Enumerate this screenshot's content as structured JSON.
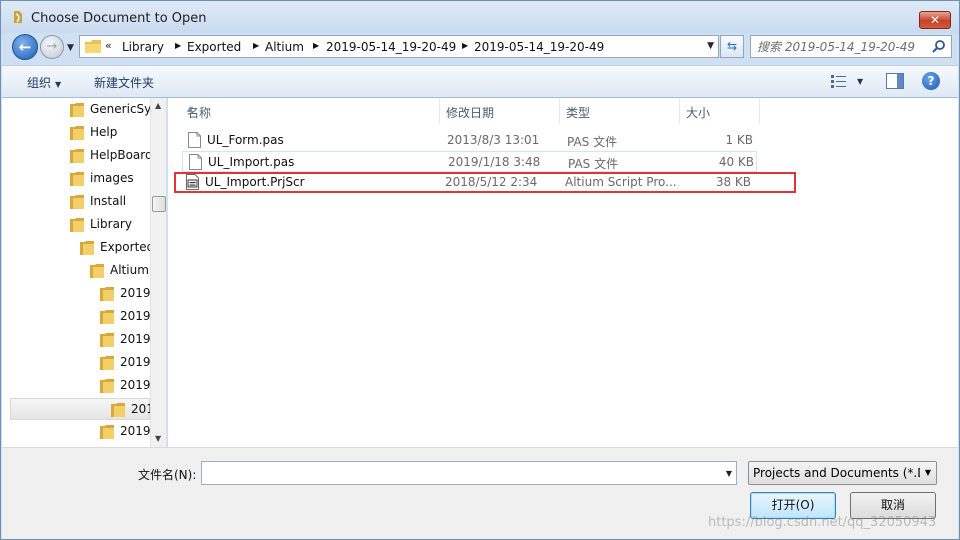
{
  "window": {
    "title": "Choose Document to Open",
    "close_label": "✕"
  },
  "address": {
    "breadcrumbs": [
      "Library",
      "Exported",
      "Altium",
      "2019-05-14_19-20-49",
      "2019-05-14_19-20-49"
    ],
    "overflow_glyph": "«"
  },
  "search": {
    "placeholder": "搜索 2019-05-14_19-20-49"
  },
  "toolbar": {
    "organize_label": "组织",
    "new_folder_label": "新建文件夹"
  },
  "nav_tree": [
    {
      "label": "GenericSy",
      "indent": 0
    },
    {
      "label": "Help",
      "indent": 0
    },
    {
      "label": "HelpBoard",
      "indent": 0
    },
    {
      "label": "images",
      "indent": 0
    },
    {
      "label": "Install",
      "indent": 0
    },
    {
      "label": "Library",
      "indent": 0
    },
    {
      "label": "Exported",
      "indent": 1
    },
    {
      "label": "Altium",
      "indent": 2
    },
    {
      "label": "2019",
      "indent": 3
    },
    {
      "label": "2019",
      "indent": 3
    },
    {
      "label": "2019",
      "indent": 3
    },
    {
      "label": "2019",
      "indent": 3
    },
    {
      "label": "2019",
      "indent": 3
    },
    {
      "label": "201",
      "indent": 4,
      "selected": true
    },
    {
      "label": "2019",
      "indent": 3
    }
  ],
  "columns": {
    "name": "名称",
    "date": "修改日期",
    "type": "类型",
    "size": "大小"
  },
  "files": [
    {
      "name": "UL_Form.pas",
      "date": "2013/8/3 13:01",
      "type": "PAS 文件",
      "size": "1 KB",
      "icon": "document-icon"
    },
    {
      "name": "UL_Import.pas",
      "date": "2019/1/18 3:48",
      "type": "PAS 文件",
      "size": "40 KB",
      "icon": "document-icon",
      "hover": true
    },
    {
      "name": "UL_Import.PrjScr",
      "date": "2018/5/12 2:34",
      "type": "Altium Script Pro...",
      "size": "38 KB",
      "icon": "script-project-icon",
      "highlighted": true
    }
  ],
  "bottom": {
    "filename_label": "文件名(N):",
    "filename_value": "",
    "filter_value": "Projects and Documents (*.D",
    "open_label": "打开(O)",
    "cancel_label": "取消",
    "watermark": "https://blog.csdn.net/qq_32050943"
  },
  "colors": {
    "highlight_border": "#e0333a",
    "accent": "#1e5fb8"
  }
}
